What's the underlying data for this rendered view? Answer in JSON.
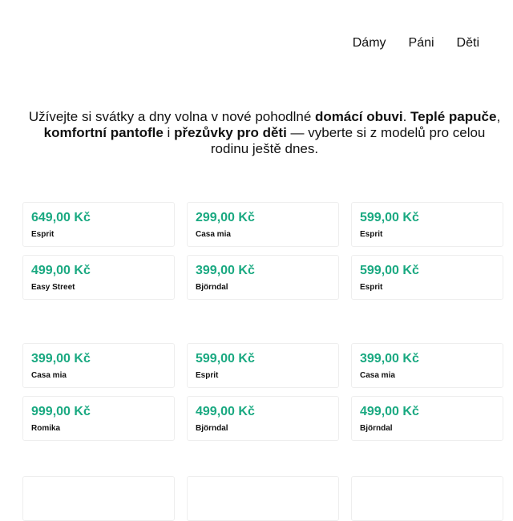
{
  "nav": {
    "items": [
      {
        "label": "Dámy"
      },
      {
        "label": "Páni"
      },
      {
        "label": "Děti"
      }
    ]
  },
  "intro": {
    "p1": "Užívejte si svátky a dny volna v nové pohodlné ",
    "b1": "domácí obuvi",
    "p2": ". ",
    "b2": "Teplé papuče",
    "p3": ", ",
    "b3": "komfortní pantofle",
    "p4": " i ",
    "b4": "přezůvky pro děti",
    "p5": " — vyberte si z modelů pro celou rodinu ještě dnes."
  },
  "products": [
    {
      "price": "649,00 Kč",
      "brand": "Esprit"
    },
    {
      "price": "299,00 Kč",
      "brand": "Casa mia"
    },
    {
      "price": "599,00 Kč",
      "brand": "Esprit"
    },
    {
      "price": "499,00 Kč",
      "brand": "Easy Street"
    },
    {
      "price": "399,00 Kč",
      "brand": "Björndal"
    },
    {
      "price": "599,00 Kč",
      "brand": "Esprit"
    },
    {
      "price": "399,00 Kč",
      "brand": "Casa mia"
    },
    {
      "price": "599,00 Kč",
      "brand": "Esprit"
    },
    {
      "price": "399,00 Kč",
      "brand": "Casa mia"
    },
    {
      "price": "999,00 Kč",
      "brand": "Romika"
    },
    {
      "price": "499,00 Kč",
      "brand": "Björndal"
    },
    {
      "price": "499,00 Kč",
      "brand": "Björndal"
    }
  ],
  "colors": {
    "price": "#1aa981",
    "text": "#111111",
    "card_border": "#eeeeee"
  }
}
